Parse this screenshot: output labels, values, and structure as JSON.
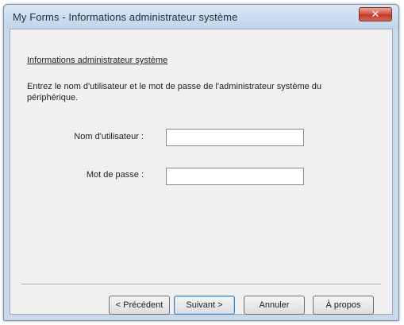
{
  "window": {
    "title": "My Forms - Informations administrateur système",
    "close_glyph": "✕"
  },
  "content": {
    "heading": "Informations administrateur système",
    "instructions": "Entrez le nom d'utilisateur et le mot de passe de l'administrateur système du périphérique.",
    "username": {
      "label": "Nom d'utilisateur :",
      "value": ""
    },
    "password": {
      "label": "Mot de passe :",
      "value": ""
    }
  },
  "buttons": {
    "previous": "< Précédent",
    "next": "Suivant >",
    "cancel": "Annuler",
    "about": "À propos"
  },
  "colors": {
    "title_bar": "#c9d9ea",
    "close_button": "#c0392b",
    "client_area": "#f0f0f0"
  }
}
